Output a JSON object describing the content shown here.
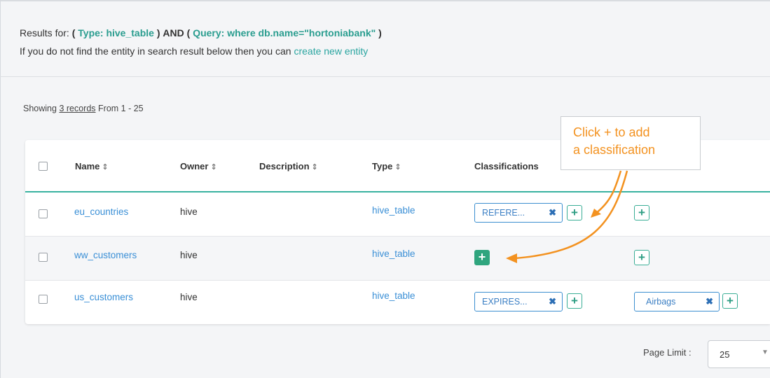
{
  "results": {
    "prefix": "Results for:",
    "open1": "(",
    "type_label": "Type: hive_table",
    "close1": ")",
    "and": "AND",
    "open2": "(",
    "query_label": "Query: where db.name=\"hortoniabank\"",
    "close2": ")",
    "hint_text": "If you do not find the entity in search result below then you can",
    "hint_link": "create new entity"
  },
  "showing": {
    "prefix": "Showing",
    "count_link": "3 records",
    "suffix": "From 1 - 25"
  },
  "table": {
    "headers": {
      "name": "Name",
      "owner": "Owner",
      "description": "Description",
      "type": "Type",
      "classifications": "Classifications",
      "sort_glyph": "⇕"
    },
    "rows": [
      {
        "name": "eu_countries",
        "owner": "hive",
        "type": "hive_table",
        "classification_tag": "REFERE...",
        "term_tag": ""
      },
      {
        "name": "ww_customers",
        "owner": "hive",
        "type": "hive_table",
        "classification_tag": "",
        "term_tag": ""
      },
      {
        "name": "us_customers",
        "owner": "hive",
        "type": "hive_table",
        "classification_tag": "EXPIRES...",
        "term_tag": "Airbags"
      }
    ],
    "remove_glyph": "✖",
    "add_glyph": "+"
  },
  "callout": {
    "line1": "Click + to add",
    "line2": "a classification"
  },
  "pagination": {
    "label": "Page Limit :",
    "value": "25",
    "caret": "▼"
  },
  "colors": {
    "accent": "#2fa57e",
    "link": "#3a8fd6",
    "callout": "#f39220"
  }
}
